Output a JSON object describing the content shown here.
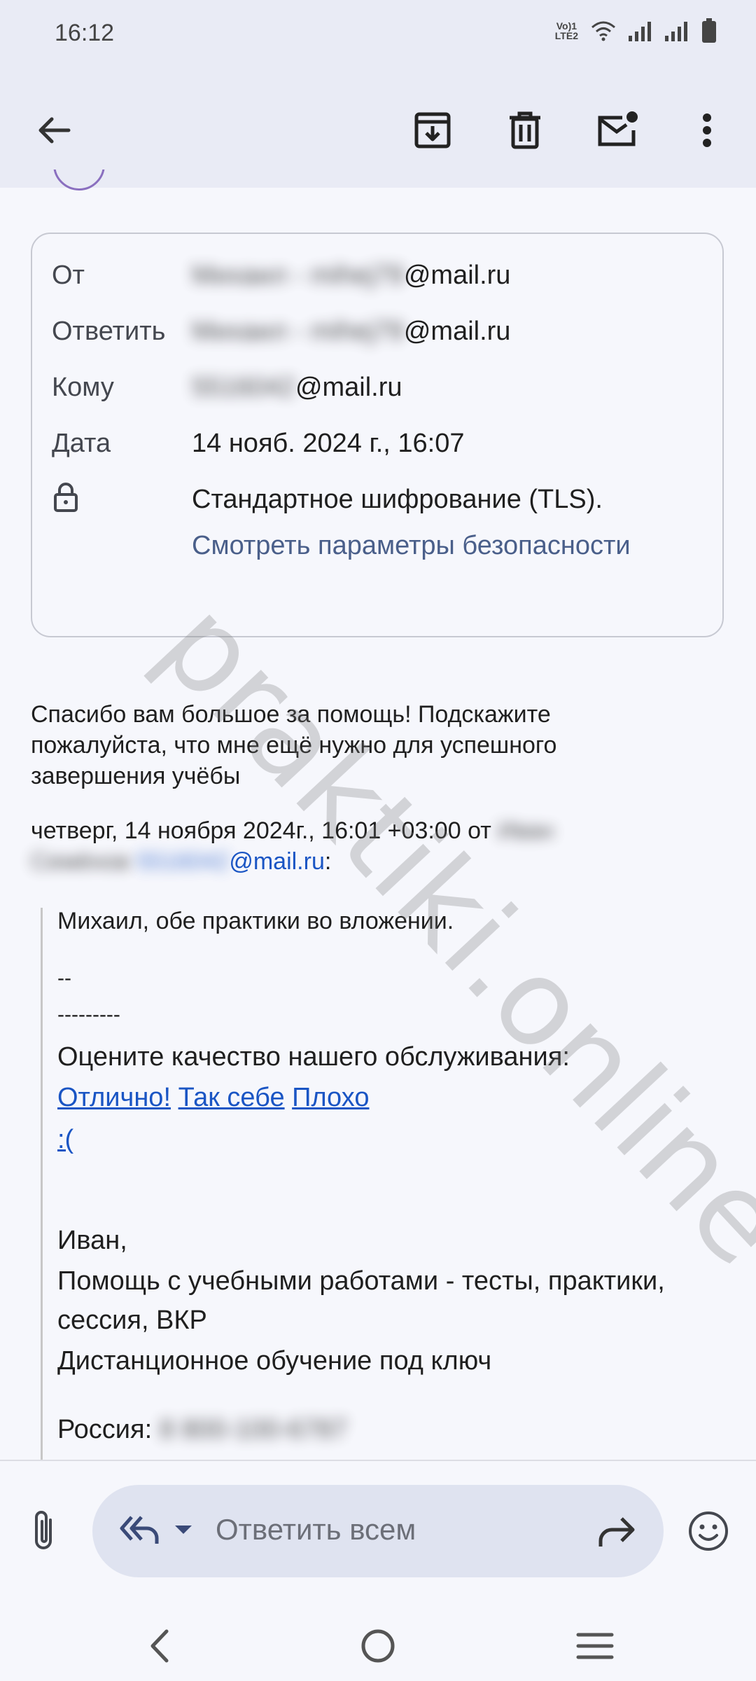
{
  "status_bar": {
    "time": "16:12",
    "network": "VoLTE1 LTE2"
  },
  "toolbar": {
    "back": "back-arrow-icon",
    "archive": "archive-icon",
    "delete": "trash-icon",
    "mark_unread": "mail-unread-icon",
    "more": "more-vert-icon"
  },
  "details": {
    "from_label": "От",
    "from_name_blurred": "Михаил - mihej79",
    "from_domain": "@mail.ru",
    "reply_to_label": "Ответить",
    "reply_to_name_blurred": "Михаил - mihej79",
    "reply_to_domain": "@mail.ru",
    "to_label": "Кому",
    "to_name_blurred": "5516042",
    "to_domain": "@mail.ru",
    "date_label": "Дата",
    "date_value": "14 нояб. 2024 г., 16:07",
    "encryption_text": "Стандартное шифрование (TLS).",
    "security_link": "Смотреть параметры безопасности"
  },
  "message": {
    "line1": "Спасибо вам большое за помощь!  Подскажите",
    "line2": "пожалуйста, что мне ещё нужно для успешного",
    "line3": "завершения учёбы",
    "quote_header_1": "четверг, 14 ноября 2024г., 16:01 +03:00 от ",
    "quote_header_blur_1": "Иван",
    "quote_header_blur_2": "Семёнов",
    "quote_header_email_blur": "5516042",
    "quote_header_email_domain": "@mail.ru",
    "quote_header_colon": ":"
  },
  "quoted": {
    "attachment_note": "Михаил, обе практики во вложении.",
    "sig_dash1": "--",
    "sig_dash2": "---------",
    "rate_prompt": "Оцените качество нашего обслуживания:",
    "rate_excellent": "Отлично!",
    "rate_ok": "Так себе",
    "rate_bad": "Плохо",
    "rate_sad": ":(",
    "name": "Иван,",
    "services_1": "Помощь с учебными работами - тесты, практики,",
    "services_2": "сессия, ВКР",
    "services_3": "Дистанционное обучение под ключ",
    "russia_label": "Россия: ",
    "russia_phone_blurred": "8 800-100-6787"
  },
  "watermark": "praktiki.online",
  "reply_bar": {
    "placeholder": "Ответить всем",
    "attach": "paperclip-icon",
    "reply_all": "reply-all-icon",
    "forward": "forward-icon",
    "emoji": "emoji-icon"
  },
  "colors": {
    "link": "#1a55c4",
    "security_link": "#4a5f8a",
    "toolbar_bg": "#e9ebf5",
    "reply_pill": "#dfe3f0"
  }
}
